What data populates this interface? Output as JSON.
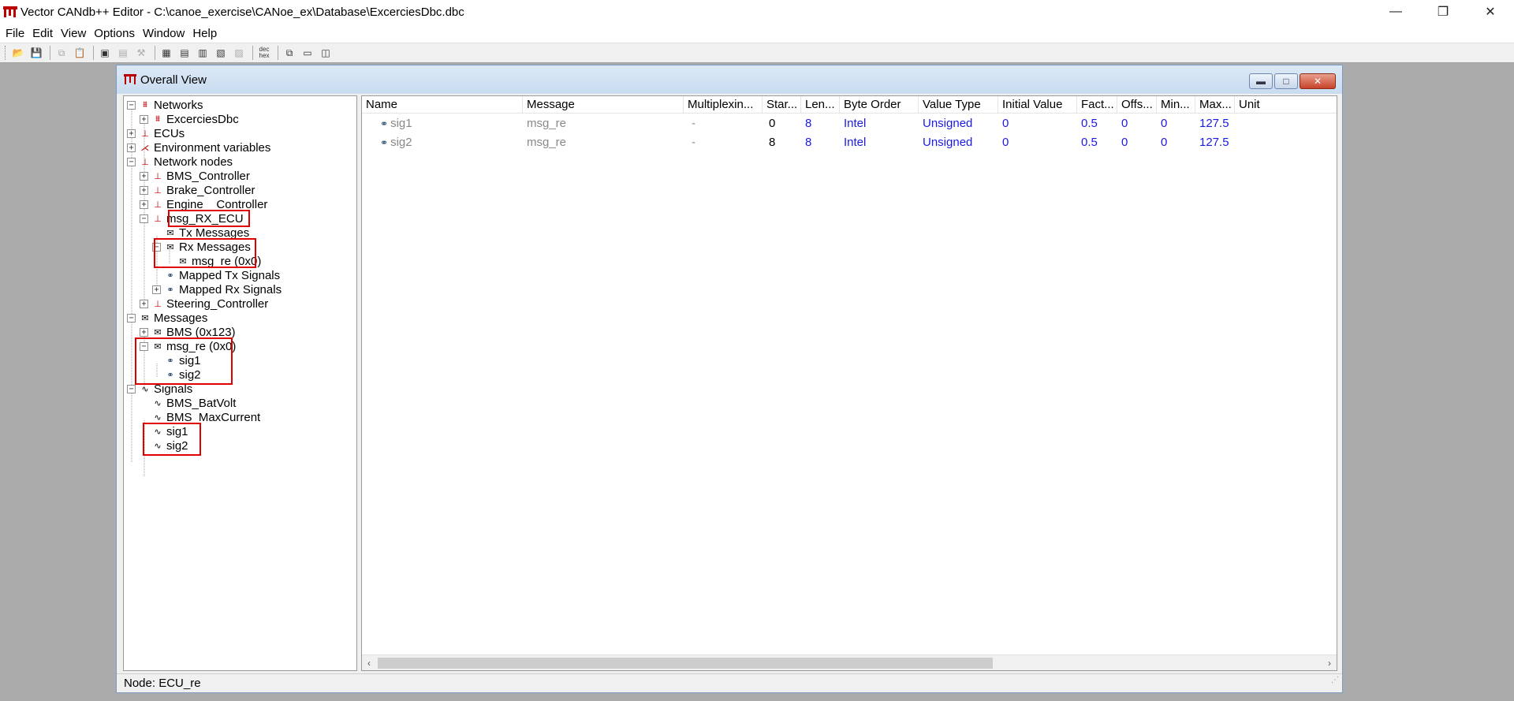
{
  "app": {
    "title": "Vector CANdb++ Editor - C:\\canoe_exercise\\CANoe_ex\\Database\\ExcerciesDbc.dbc"
  },
  "menu": [
    "File",
    "Edit",
    "View",
    "Options",
    "Window",
    "Help"
  ],
  "window": {
    "title": "Overall View"
  },
  "tree": [
    {
      "label": "Networks",
      "expander": "−",
      "icon": "network-icon"
    },
    {
      "label": "ExcerciesDbc",
      "expander": "+",
      "icon": "network-icon"
    },
    {
      "label": "ECUs",
      "expander": "+",
      "icon": "ecu-icon"
    },
    {
      "label": "Environment variables",
      "expander": "+",
      "icon": "env-var-icon"
    },
    {
      "label": "Network nodes",
      "expander": "−",
      "icon": "node-icon"
    },
    {
      "label": "BMS_Controller",
      "expander": "+",
      "icon": "node-icon"
    },
    {
      "label": "Brake_Controller",
      "expander": "+",
      "icon": "node-icon"
    },
    {
      "label": "Engine__Controller",
      "expander": "+",
      "icon": "node-icon"
    },
    {
      "label": "msg_RX_ECU",
      "expander": "−",
      "icon": "node-icon"
    },
    {
      "label": "Tx Messages",
      "expander": "",
      "icon": "message-icon"
    },
    {
      "label": "Rx Messages",
      "expander": "−",
      "icon": "message-icon"
    },
    {
      "label": "msg_re (0x0)",
      "expander": "",
      "icon": "message-icon"
    },
    {
      "label": "Mapped Tx Signals",
      "expander": "",
      "icon": "mapped-signal-icon"
    },
    {
      "label": "Mapped Rx Signals",
      "expander": "+",
      "icon": "mapped-signal-icon"
    },
    {
      "label": "Steering_Controller",
      "expander": "+",
      "icon": "node-icon"
    },
    {
      "label": "Messages",
      "expander": "−",
      "icon": "message-icon"
    },
    {
      "label": "BMS (0x123)",
      "expander": "+",
      "icon": "message-icon"
    },
    {
      "label": "msg_re (0x0)",
      "expander": "−",
      "icon": "message-icon"
    },
    {
      "label": "sig1",
      "expander": "",
      "icon": "signal-icon"
    },
    {
      "label": "sig2",
      "expander": "",
      "icon": "signal-icon"
    },
    {
      "label": "Signals",
      "expander": "−",
      "icon": "signal-wave-icon"
    },
    {
      "label": "BMS_BatVolt",
      "expander": "",
      "icon": "signal-wave-icon"
    },
    {
      "label": "BMS_MaxCurrent",
      "expander": "",
      "icon": "signal-wave-icon"
    },
    {
      "label": "sig1",
      "expander": "",
      "icon": "signal-wave-icon"
    },
    {
      "label": "sig2",
      "expander": "",
      "icon": "signal-wave-icon"
    }
  ],
  "grid": {
    "columns": [
      "Name",
      "Message",
      "Multiplexin...",
      "Star...",
      "Len...",
      "Byte Order",
      "Value Type",
      "Initial Value",
      "Fact...",
      "Offs...",
      "Min...",
      "Max...",
      "Unit"
    ],
    "rows": [
      {
        "name": "sig1",
        "message": "msg_re",
        "mux": "-",
        "start": "0",
        "len": "8",
        "byte_order": "Intel",
        "value_type": "Unsigned",
        "initial": "0",
        "factor": "0.5",
        "offset": "0",
        "min": "0",
        "max": "127.5",
        "unit": ""
      },
      {
        "name": "sig2",
        "message": "msg_re",
        "mux": "-",
        "start": "8",
        "len": "8",
        "byte_order": "Intel",
        "value_type": "Unsigned",
        "initial": "0",
        "factor": "0.5",
        "offset": "0",
        "min": "0",
        "max": "127.5",
        "unit": ""
      }
    ]
  },
  "status": {
    "text": "Node: ECU_re"
  },
  "colors": {
    "highlight": "#e00000",
    "value_blue": "#1a1ae6",
    "node_red": "#c00000"
  }
}
